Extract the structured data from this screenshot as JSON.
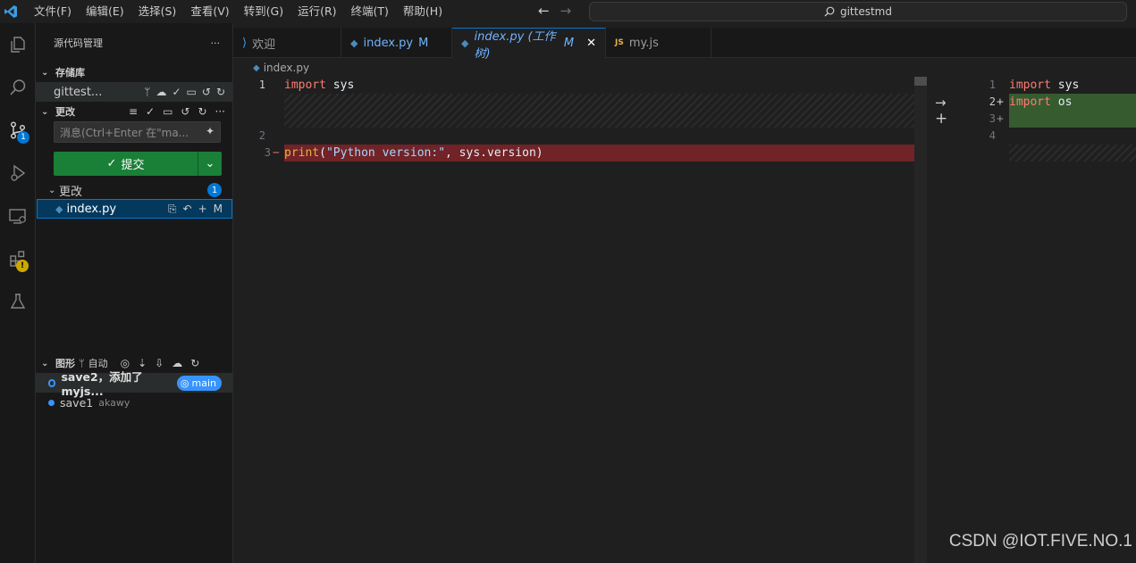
{
  "menu": [
    "文件(F)",
    "编辑(E)",
    "选择(S)",
    "查看(V)",
    "转到(G)",
    "运行(R)",
    "终端(T)",
    "帮助(H)"
  ],
  "search": {
    "text": "gittestmd"
  },
  "activity": {
    "scm_badge": "1"
  },
  "sidebar": {
    "title": "源代码管理",
    "repos_section": "存储库",
    "repo_name": "gittest...",
    "changes_section": "更改",
    "message_placeholder": "消息(Ctrl+Enter 在\"ma...",
    "commit_label": "提交",
    "changes_group_label": "更改",
    "changes_count": "1",
    "file": {
      "name": "index.py",
      "status": "M"
    },
    "graph_section": "图形",
    "graph_auto": "自动",
    "commits": [
      {
        "message": "save2，添加了myjs...",
        "ref": "main"
      },
      {
        "message": "save1",
        "author": "akawy"
      }
    ]
  },
  "tabs": [
    {
      "label": "欢迎",
      "mod": ""
    },
    {
      "label": "index.py",
      "mod": "M"
    },
    {
      "label": "index.py (工作树)",
      "mod": "M"
    },
    {
      "label": "my.js",
      "mod": ""
    }
  ],
  "breadcrumb": "index.py",
  "diff": {
    "left": {
      "line1_no": "1",
      "line1_kw": "import",
      "line1_id": " sys",
      "line2_no": "2",
      "line3_no": "3",
      "line3_marker": "−",
      "line3_fn": "print",
      "line3_p1": "(",
      "line3_str": "\"Python version:\"",
      "line3_rest": ", sys.version)"
    },
    "right": {
      "line1_no": "1",
      "line1_kw": "import",
      "line1_id": " sys",
      "line2_no": "2",
      "line2_marker": "+",
      "line2_kw": "import",
      "line2_id": " os",
      "line3_no": "3",
      "line3_marker": "+",
      "line4_no": "4"
    }
  },
  "watermark": "CSDN @IOT.FIVE.NO.1",
  "colors": {
    "accent": "#0078d4",
    "commit_button": "#1a7f37",
    "removed": "#7a2a2e",
    "added": "#3f6b3a"
  }
}
